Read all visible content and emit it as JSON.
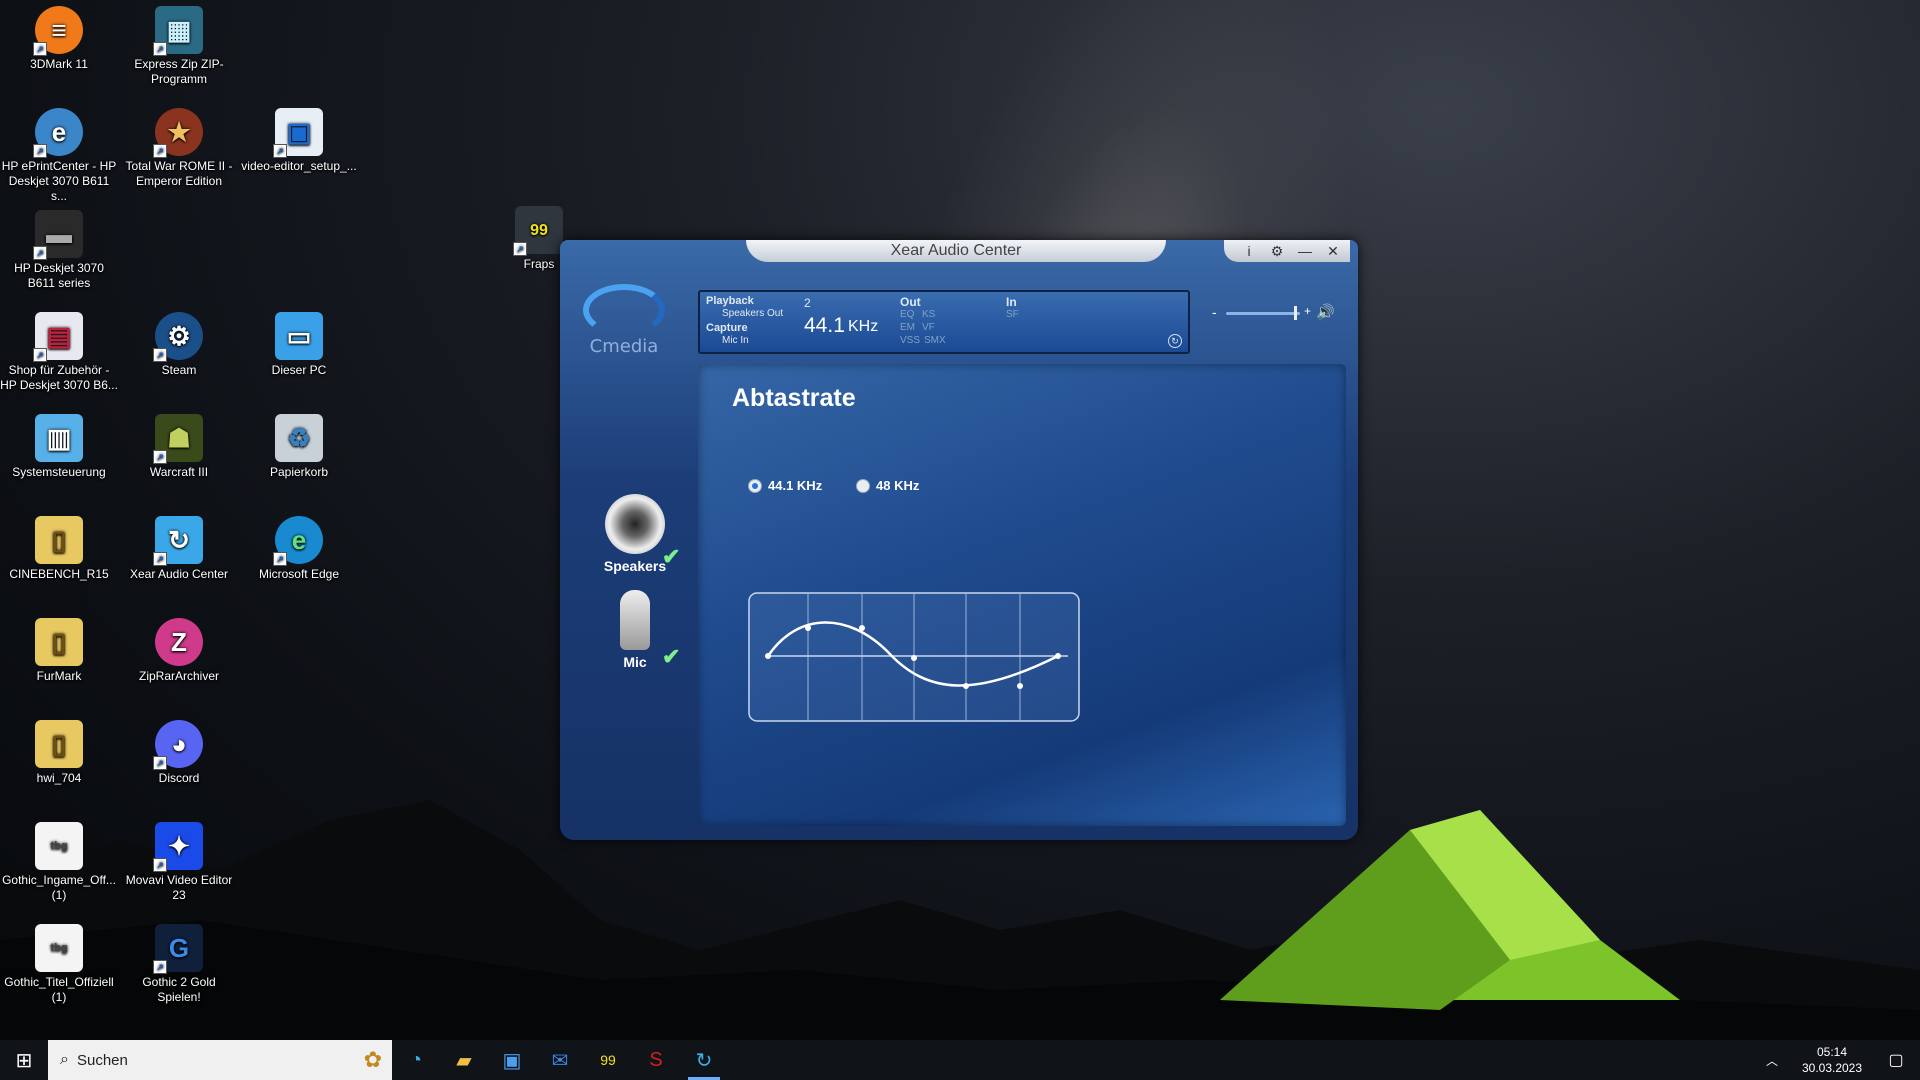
{
  "desktop": {
    "icons": [
      {
        "label": "3DMark 11"
      },
      {
        "label": "Express Zip ZIP-Programm"
      },
      {
        "label": "HP ePrintCenter - HP Deskjet 3070 B611 s..."
      },
      {
        "label": "Total War ROME II - Emperor Edition"
      },
      {
        "label": "video-editor_setup_..."
      },
      {
        "label": "Fraps"
      },
      {
        "label": "HP Deskjet 3070 B611 series"
      },
      {
        "label": "Shop für Zubehör - HP Deskjet 3070 B6..."
      },
      {
        "label": "Steam"
      },
      {
        "label": "Dieser PC"
      },
      {
        "label": "Systemsteuerung"
      },
      {
        "label": "Warcraft III"
      },
      {
        "label": "Papierkorb"
      },
      {
        "label": "CINEBENCH_R15"
      },
      {
        "label": "Xear Audio Center"
      },
      {
        "label": "Microsoft Edge"
      },
      {
        "label": "FurMark"
      },
      {
        "label": "ZipRarArchiver"
      },
      {
        "label": "hwi_704"
      },
      {
        "label": "Discord"
      },
      {
        "label": "Gothic_Ingame_Off... (1)"
      },
      {
        "label": "Movavi Video Editor 23"
      },
      {
        "label": "Gothic_Titel_Offiziell (1)"
      },
      {
        "label": "Gothic 2 Gold Spielen!"
      }
    ]
  },
  "xear": {
    "title": "Xear Audio Center",
    "logo_text": "Cmedia",
    "buttons": {
      "info": "i",
      "settings": "⚙",
      "minimize": "—",
      "close": "✕"
    },
    "lcd": {
      "playback": "Playback",
      "speakers_out": "Speakers Out",
      "capture": "Capture",
      "mic_in": "Mic In",
      "channels": "2",
      "rate_value": "44.1",
      "rate_unit": "KHz",
      "out": "Out",
      "in": "In",
      "eq": "EQ",
      "ks": "KS",
      "em": "EM",
      "vf": "VF",
      "vss": "VSS",
      "smx": "SMX",
      "sf": "SF"
    },
    "volume": {
      "minus": "-",
      "plus": "+",
      "level": 0.85
    },
    "page_title": "Abtastrate",
    "options": [
      {
        "label": "44.1 KHz",
        "selected": true
      },
      {
        "label": "48 KHz",
        "selected": false
      }
    ],
    "devices": [
      {
        "label": "Speakers",
        "enabled": true
      },
      {
        "label": "Mic",
        "enabled": true
      }
    ]
  },
  "taskbar": {
    "search_placeholder": "Suchen",
    "time": "05:14",
    "date": "30.03.2023"
  }
}
